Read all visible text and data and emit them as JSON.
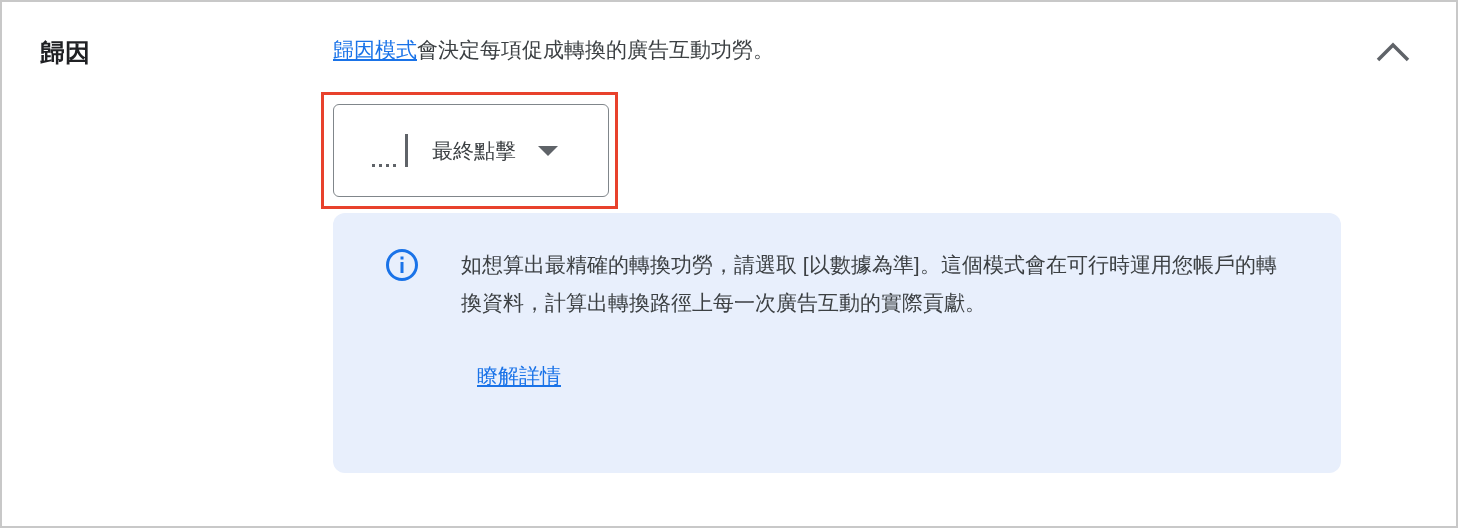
{
  "section": {
    "title": "歸因",
    "expanded": true,
    "description": {
      "link": "歸因模式",
      "text": "會決定每項促成轉換的廣告互動功勞。"
    },
    "dropdown": {
      "value": "最終點擊",
      "highlighted": true
    },
    "info": {
      "text": "如想算出最精確的轉換功勞，請選取 [以數據為準]。這個模式會在可行時運用您帳戶的轉換資料，計算出轉換路徑上每一次廣告互動的實際貢獻。",
      "link": "瞭解詳情"
    }
  }
}
